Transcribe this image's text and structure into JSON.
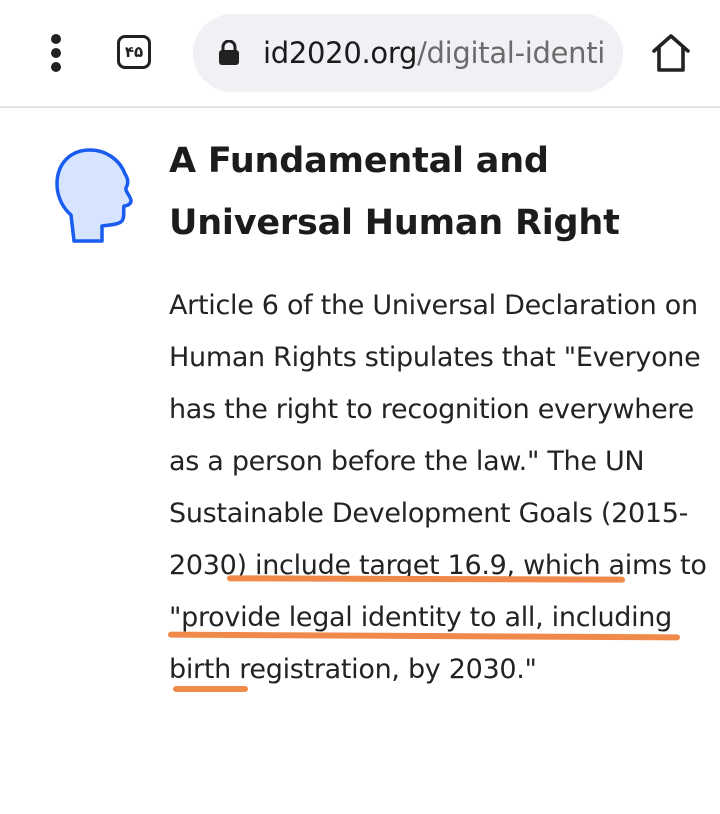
{
  "browser": {
    "tab_count": "۴۵",
    "url_host": "id2020.org",
    "url_path": "/digital-identi",
    "icons": [
      "more-vert-icon",
      "tab-switcher-icon",
      "lock-icon",
      "home-icon"
    ]
  },
  "article": {
    "icon": "human-head-icon",
    "title": "A Fundamental and Universal Human Right",
    "body": {
      "part1": "Article 6 of the Universal Declaration on Human Rights stipulates that \"Everyone has the right to recognition everywhere as a person before the law.\" The UN ",
      "link1": "Sustainable Development Goals (2015-2030) include target",
      "space": " ",
      "link2": "16.9,",
      "part2": " which aims to \"provide legal identity to all, including birth registration, by 2030.\""
    }
  },
  "colors": {
    "head_outline": "#1a5cf0",
    "head_fill": "#d6e4ff",
    "highlight_underline": "#ef8a4a",
    "url_bar_bg": "#eff1f4"
  }
}
